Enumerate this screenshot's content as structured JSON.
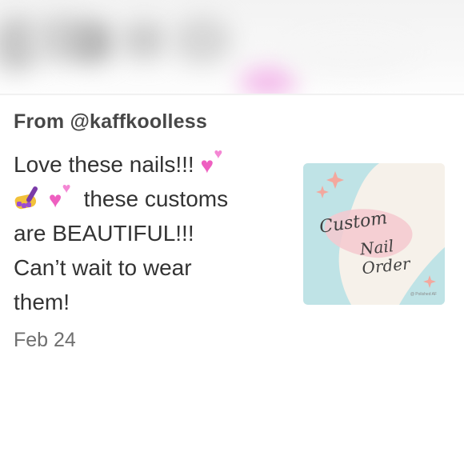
{
  "post": {
    "from_line": "From @kaffkoolless",
    "message": {
      "line1_text": "Love these nails!!!",
      "line2_text": "these customs",
      "line3_text": "are BEAUTIFUL!!!",
      "line4_text": "Can’t wait to wear",
      "line5_text": "them!"
    },
    "date": "Feb 24",
    "emojis": [
      "two-hearts-icon",
      "nail-polish-icon",
      "two-hearts-icon"
    ]
  },
  "thumbnail": {
    "title_line1": "Custom",
    "title_line2": "Nail Order",
    "credit": "@ Polished AF",
    "colors": {
      "background": "#f6f1ea",
      "teal_shape": "#bfe3e6",
      "pink_shape": "#f5c9cf",
      "sparkle": "#f3a89e"
    }
  },
  "colors": {
    "heart_pink": "#ee5fc0",
    "text_dark": "#333333",
    "text_muted": "#6f6f6f"
  }
}
